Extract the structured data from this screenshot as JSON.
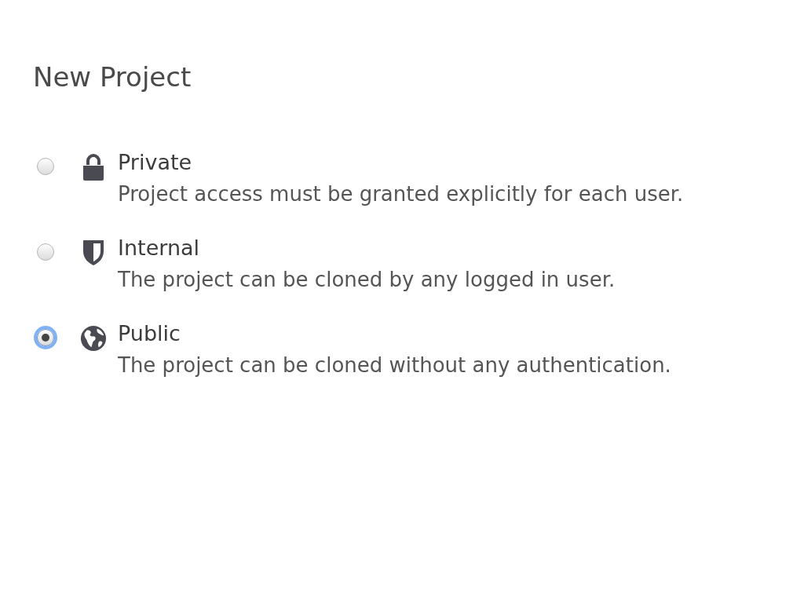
{
  "title": "New Project",
  "options": [
    {
      "kind": "private",
      "label": "Private",
      "description": "Project access must be granted explicitly for each user.",
      "selected": false
    },
    {
      "kind": "internal",
      "label": "Internal",
      "description": "The project can be cloned by any logged in user.",
      "selected": false
    },
    {
      "kind": "public",
      "label": "Public",
      "description": "The project can be cloned without any authentication.",
      "selected": true
    }
  ]
}
